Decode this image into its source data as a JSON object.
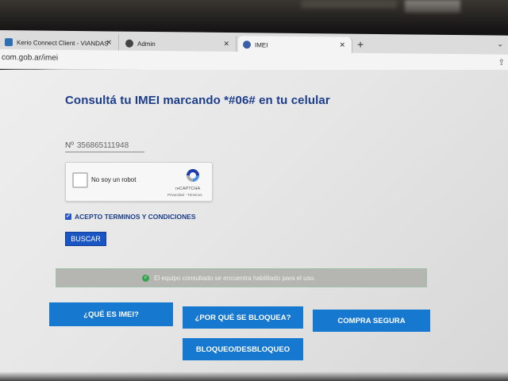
{
  "browser": {
    "tabs": [
      {
        "label": "Kerio Connect Client - VIANDAS",
        "favicon_color": "#2c6fb3",
        "active": false
      },
      {
        "label": "Admin",
        "favicon_color": "#444444",
        "active": false
      },
      {
        "label": "IMEI",
        "favicon_color": "#3a5ea8",
        "active": true
      }
    ],
    "close_glyph": "✕",
    "newtab_glyph": "+",
    "chevron_glyph": "⌄",
    "url": "com.gob.ar/imei",
    "share_glyph": "⇪"
  },
  "page": {
    "title": "Consultá tu IMEI marcando *#06# en tu celular",
    "imei_prefix": "Nº",
    "imei_value": "356865111948",
    "recaptcha": {
      "label": "No soy un robot",
      "brand": "reCAPTCHA",
      "links": "Privacidad - Términos"
    },
    "terms_label": "ACEPTO TERMINOS Y CONDICIONES",
    "terms_checked": true,
    "search_button": "BUSCAR",
    "alert_text": "El equipo consultado se encuentra habilitado para el uso.",
    "alert_icon": "✓",
    "buttons": {
      "que_es": "¿QUÉ ES IMEI?",
      "por_que": "¿POR QUÉ SE BLOQUEA?",
      "compra": "COMPRA SEGURA",
      "bloqueo": "BLOQUEO/DESBLOQUEO"
    }
  },
  "colors": {
    "title": "#1c3d8a",
    "button": "#1678cf",
    "alert_bg": "#b5b5b1",
    "success": "#37a24f"
  }
}
